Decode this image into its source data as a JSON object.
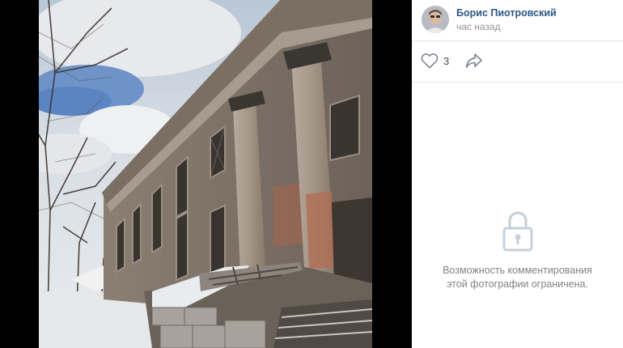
{
  "author": {
    "name": "Борис Пиотровский",
    "time": "час назад"
  },
  "actions": {
    "like_count": "3",
    "like_icon": "heart-outline",
    "share_icon": "share-arrow"
  },
  "comments": {
    "lock_icon": "padlock",
    "restricted_message": "Возможность комментирования этой фотографии ограничена."
  },
  "colors": {
    "link": "#2a5885",
    "muted": "#828282",
    "background": "#000000"
  }
}
